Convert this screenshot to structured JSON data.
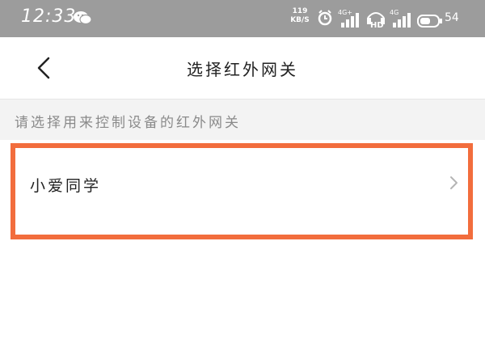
{
  "status_bar": {
    "time": "12:33",
    "net_speed": "119",
    "net_speed_unit": "KB/S",
    "signal1_label": "4G+",
    "hd_label": "HD",
    "signal2_label": "4G",
    "battery": "54",
    "icons": [
      "wechat-icon",
      "alarm-icon",
      "signal-icon",
      "hd-icon",
      "signal-icon",
      "battery-icon"
    ]
  },
  "header": {
    "title": "选择红外网关",
    "back_icon": "chevron-left-icon"
  },
  "hint": {
    "text": "请选择用来控制设备的红外网关"
  },
  "gateways": [
    {
      "label": "小爱同学",
      "icon": "chevron-right-icon"
    }
  ],
  "colors": {
    "status_bar_bg": "#9c9c9c",
    "hint_bg": "#f3f3f3",
    "highlight": "#f26d3d"
  }
}
